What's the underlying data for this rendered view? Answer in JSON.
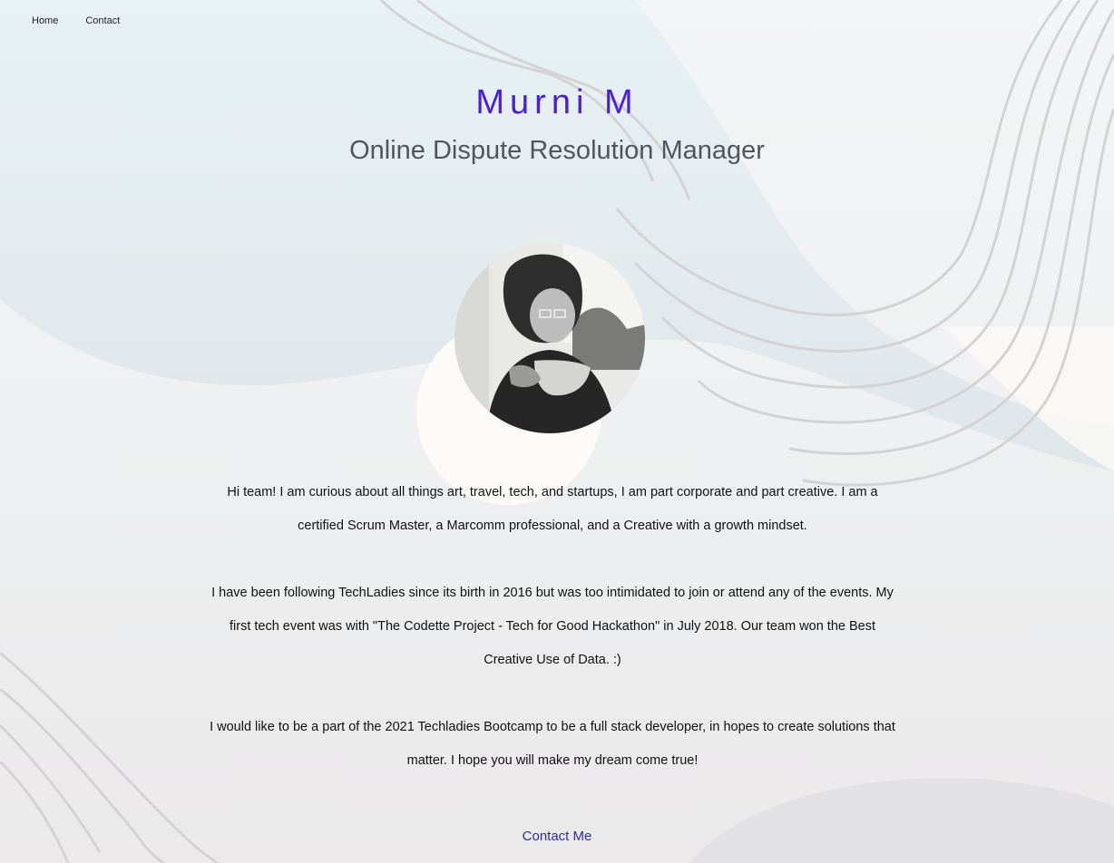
{
  "nav": {
    "home_label": "Home",
    "contact_label": "Contact"
  },
  "hero": {
    "name": "Murni M",
    "role": "Online Dispute Resolution Manager"
  },
  "bio": {
    "paragraphs": [
      "Hi team! I am curious about all things art, travel, tech, and startups, I am part corporate and part creative. I am a certified Scrum Master, a Marcomm professional, and a Creative with a growth mindset.",
      "I have been following TechLadies since its birth in 2016 but was too intimidated to join or attend any of the events. My first tech event was with \"The Codette Project - Tech for Good Hackathon\" in July 2018. Our team won the Best Creative Use of Data. :)",
      "I would like to be a part of the 2021 Techladies Bootcamp to be a full stack developer, in hopes to create solutions that matter. I hope you will make my dream come true!"
    ]
  },
  "cta": {
    "label": "Contact Me"
  },
  "colors": {
    "name_accent": "#4b1fd6",
    "link": "#2e2ea8",
    "role_text": "#50565e"
  },
  "icons": {
    "profile_photo": "avatar"
  }
}
